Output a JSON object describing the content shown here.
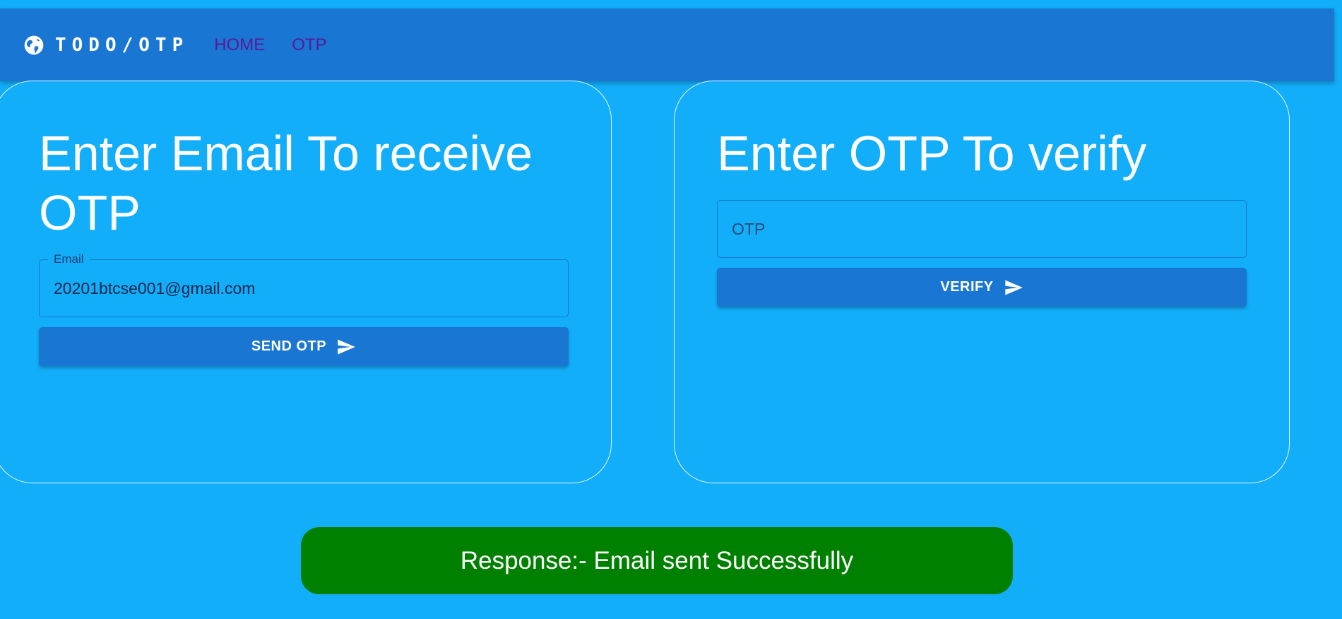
{
  "appbar": {
    "brand_icon": "globe-icon",
    "title": "TODO/OTP",
    "nav": [
      {
        "label": "HOME"
      },
      {
        "label": "OTP"
      }
    ]
  },
  "email_card": {
    "title": "Enter Email To receive OTP",
    "field_label": "Email",
    "field_value": "20201btcse001@gmail.com",
    "button_label": "SEND OTP",
    "button_icon": "send-icon"
  },
  "otp_card": {
    "title": "Enter OTP To verify",
    "field_placeholder": "OTP",
    "field_value": "",
    "button_label": "VERIFY",
    "button_icon": "send-icon"
  },
  "response": {
    "text": "Response:- Email sent Successfully"
  },
  "colors": {
    "page_bg": "#12aefa",
    "appbar_bg": "#1976d2",
    "nav_link": "#5b189a",
    "button_bg": "#1976d2",
    "success_bg": "#008000"
  }
}
